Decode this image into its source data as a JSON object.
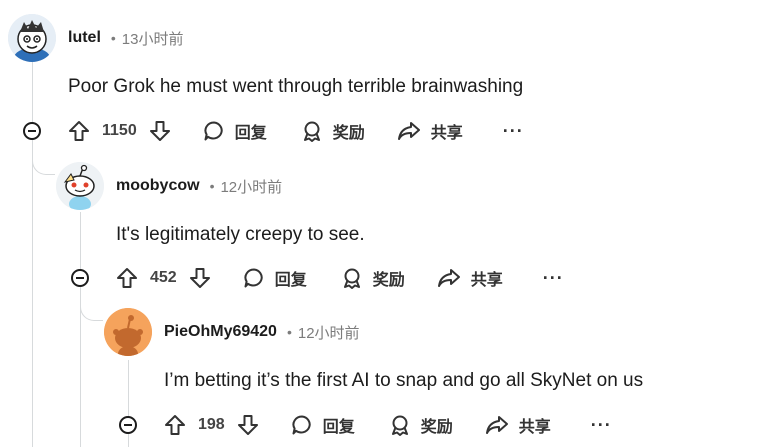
{
  "comments": [
    {
      "username": "lutel",
      "dot": "•",
      "time": "13小时前",
      "text": "Poor Grok he must went through terrible brainwashing",
      "votes": "1150",
      "reply_label": "回复",
      "award_label": "奖励",
      "share_label": "共享",
      "more_label": "···"
    },
    {
      "username": "moobycow",
      "dot": "•",
      "time": "12小时前",
      "text": "It's legitimately creepy to see.",
      "votes": "452",
      "reply_label": "回复",
      "award_label": "奖励",
      "share_label": "共享",
      "more_label": "···"
    },
    {
      "username": "PieOhMy69420",
      "dot": "•",
      "time": "12小时前",
      "text": "I’m betting it’s the first AI to snap and go all SkyNet on us",
      "votes": "198",
      "reply_label": "回复",
      "award_label": "奖励",
      "share_label": "共享",
      "more_label": "···"
    }
  ],
  "colors": {
    "thread_line": "#d7dadc",
    "avatar_orange": "#f5a35c",
    "text": "#1c1c1c",
    "muted": "#7c7c7c"
  }
}
